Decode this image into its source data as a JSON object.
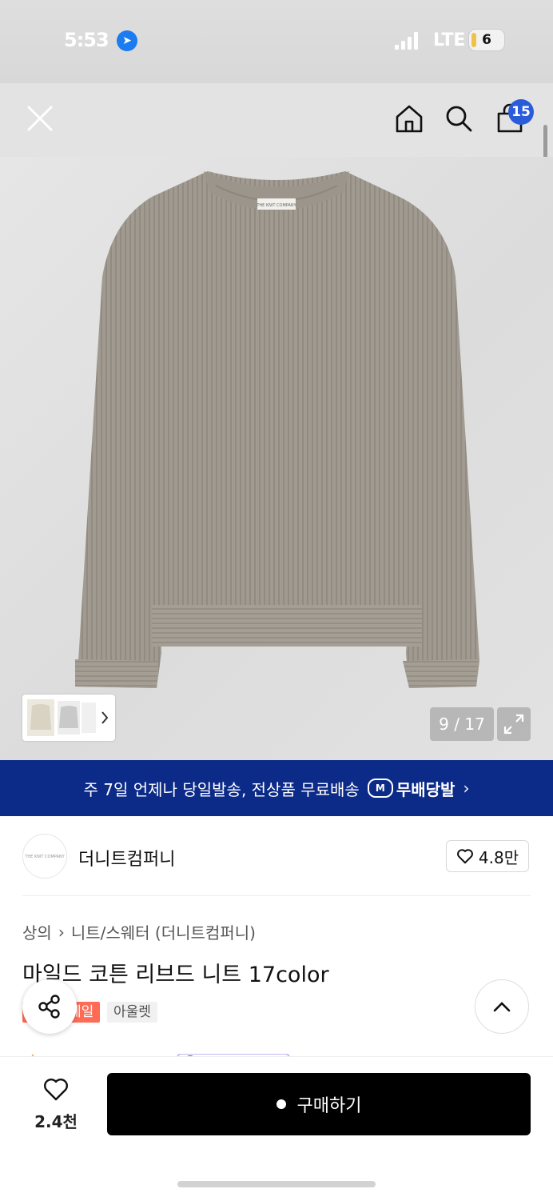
{
  "status_bar": {
    "time": "5:53",
    "network": "LTE",
    "battery": "6"
  },
  "header": {
    "cart_count": "15"
  },
  "gallery": {
    "counter": "9 / 17"
  },
  "banner": {
    "text": "주 7일 언제나 당일발송, 전상품 무료배송",
    "chip_label": "무배당발",
    "chip_mark": "M"
  },
  "brand": {
    "name": "더니트컴퍼니",
    "logo_text": "THE KNIT COMPANY",
    "likes": "4.8만"
  },
  "product": {
    "breadcrumb": [
      "상의",
      "니트/스웨터 (더니트컴퍼니)"
    ],
    "title": "마일드 코튼 리브드 니트 17color",
    "tags": [
      "세일",
      "아울렛"
    ]
  },
  "bottom_bar": {
    "wish_count": "2.4천",
    "buy_label": "구매하기"
  },
  "colors": {
    "banner_bg": "#0c2a87",
    "badge": "#2a5bd8",
    "sale_tag": "#ff6b55",
    "buy_button": "#000000"
  }
}
